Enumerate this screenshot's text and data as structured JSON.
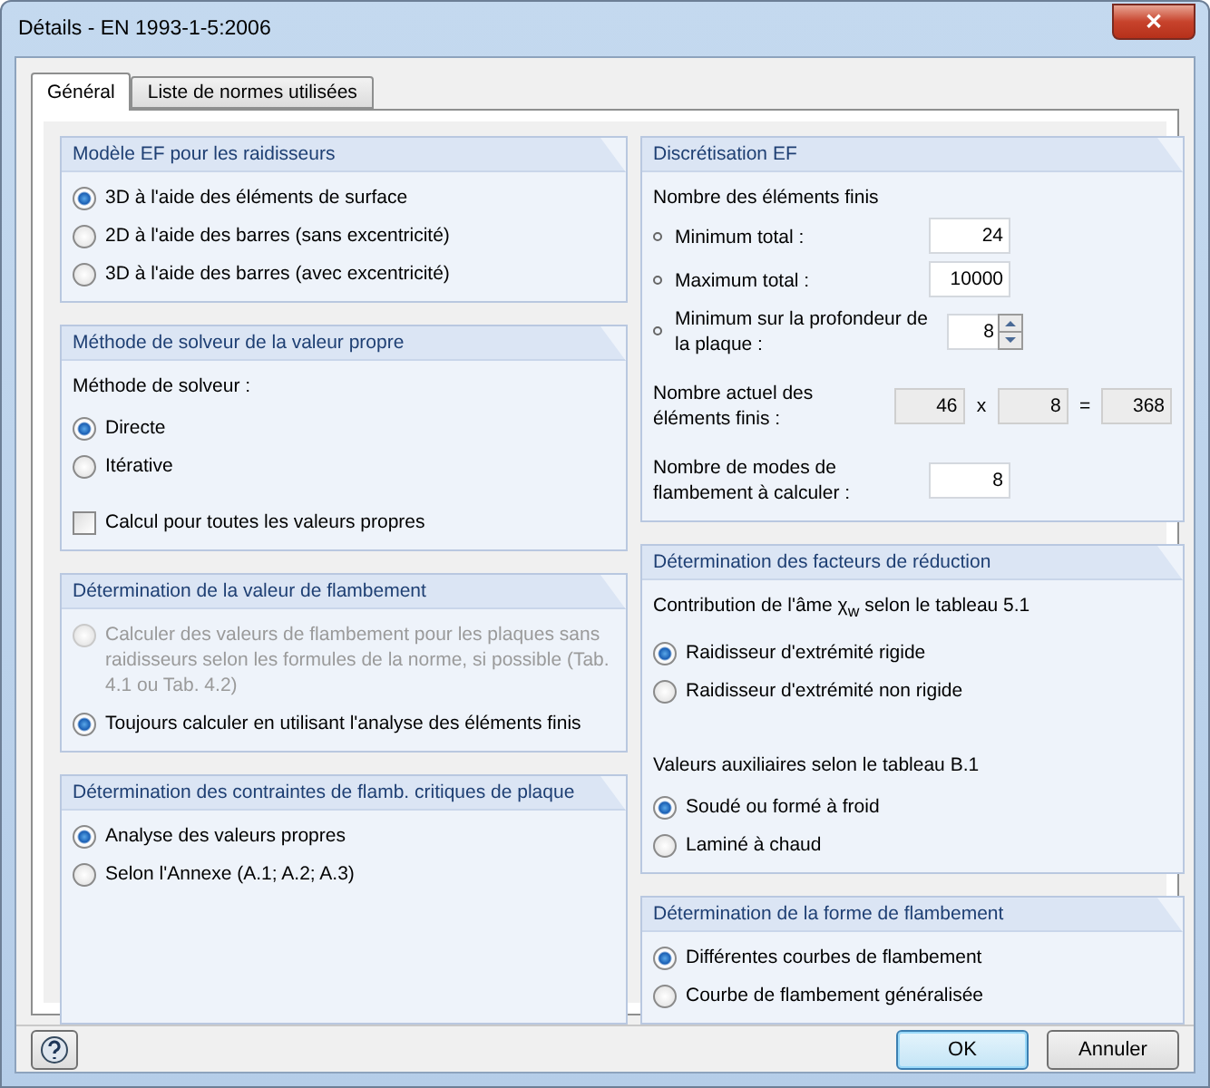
{
  "window": {
    "title": "Détails - EN 1993-1-5:2006",
    "close": "✕"
  },
  "tabs": [
    {
      "label": "Général",
      "selected": true
    },
    {
      "label": "Liste de normes utilisées",
      "selected": false
    }
  ],
  "left_column": [
    {
      "title": "Modèle EF pour les raidisseurs",
      "items": [
        {
          "kind": "radio",
          "label": "3D à l'aide des éléments de surface",
          "selected": true,
          "disabled": false
        },
        {
          "kind": "radio",
          "label": "2D à l'aide des barres (sans excentricité)",
          "selected": false,
          "disabled": false
        },
        {
          "kind": "radio",
          "label": "3D à l'aide des barres (avec excentricité)",
          "selected": false,
          "disabled": false
        }
      ]
    },
    {
      "title": "Méthode de solveur de la valeur propre",
      "items": [
        {
          "kind": "label",
          "text": "Méthode de solveur :"
        },
        {
          "kind": "radio",
          "label": "Directe",
          "selected": true,
          "disabled": false
        },
        {
          "kind": "radio",
          "label": "Itérative",
          "selected": false,
          "disabled": false
        },
        {
          "kind": "checkbox",
          "label": "Calcul pour toutes les valeurs propres",
          "checked": false
        }
      ]
    },
    {
      "title": "Détermination de la valeur de flambement",
      "items": [
        {
          "kind": "radio",
          "label": "Calculer des valeurs de flambement pour les plaques sans raidisseurs selon les formules de la norme, si possible (Tab. 4.1 ou Tab. 4.2)",
          "selected": false,
          "disabled": true
        },
        {
          "kind": "radio",
          "label": "Toujours calculer en utilisant l'analyse des éléments finis",
          "selected": true,
          "disabled": false
        }
      ]
    },
    {
      "title": "Détermination des contraintes de flamb. critiques de plaque",
      "items": [
        {
          "kind": "radio",
          "label": "Analyse des valeurs propres",
          "selected": true,
          "disabled": false
        },
        {
          "kind": "radio",
          "label": "Selon l'Annexe (A.1; A.2; A.3)",
          "selected": false,
          "disabled": false
        }
      ]
    }
  ],
  "right_column": [
    {
      "title": "Discrétisation EF",
      "items": [
        {
          "kind": "label",
          "text": "Nombre des éléments finis"
        },
        {
          "kind": "field",
          "label": "Minimum total :",
          "value": "24",
          "bullet": true,
          "spinner": false
        },
        {
          "kind": "field",
          "label": "Maximum total :",
          "value": "10000",
          "bullet": true,
          "spinner": false
        },
        {
          "kind": "field",
          "label": "Minimum sur la profondeur de la plaque :",
          "value": "8",
          "bullet": true,
          "spinner": true
        },
        {
          "kind": "product",
          "label": "Nombre actuel des éléments finis :",
          "factor_1": "46",
          "times": "x",
          "factor_2": "8",
          "equals": "=",
          "result": "368"
        },
        {
          "kind": "field",
          "label": "Nombre de modes de flambement à calculer :",
          "value": "8",
          "bullet": false,
          "spinner": false
        }
      ]
    },
    {
      "title": "Détermination des facteurs de réduction",
      "items": [
        {
          "kind": "label",
          "text": "Contribution de l'âme χ$_{w}$ selon le tableau 5.1"
        },
        {
          "kind": "radio",
          "label": "Raidisseur d'extrémité rigide",
          "selected": true,
          "disabled": false
        },
        {
          "kind": "radio",
          "label": "Raidisseur d'extrémité non rigide",
          "selected": false,
          "disabled": false
        },
        {
          "kind": "label",
          "text": "Valeurs auxiliaires selon le tableau B.1"
        },
        {
          "kind": "radio",
          "label": "Soudé ou formé à froid",
          "selected": true,
          "disabled": false
        },
        {
          "kind": "radio",
          "label": "Laminé à chaud",
          "selected": false,
          "disabled": false
        }
      ]
    },
    {
      "title": "Détermination de la forme de flambement",
      "items": [
        {
          "kind": "radio",
          "label": "Différentes courbes de flambement",
          "selected": true,
          "disabled": false
        },
        {
          "kind": "radio",
          "label": "Courbe de flambement généralisée",
          "selected": false,
          "disabled": false
        }
      ]
    }
  ],
  "buttons": [
    {
      "label": "OK",
      "default": true
    },
    {
      "label": "Annuler",
      "default": false
    }
  ]
}
